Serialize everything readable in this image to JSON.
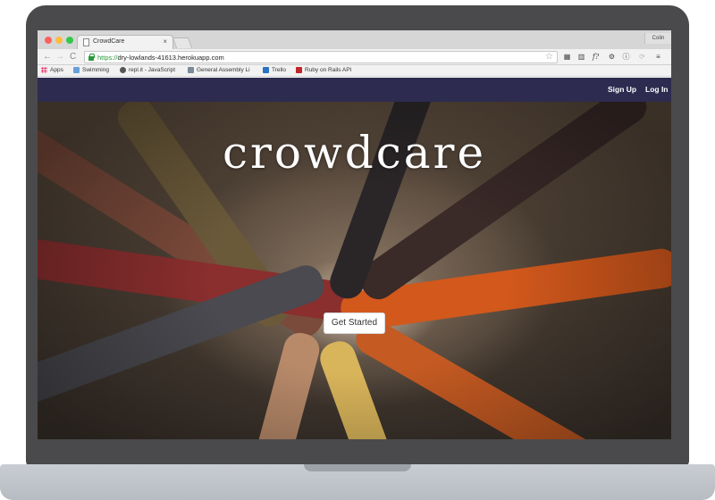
{
  "browser": {
    "tab_title": "CrowdCare",
    "tab_close": "×",
    "profile_name": "Colin",
    "url_protocol": "https://",
    "url_host": "dry-lowlands-41613.herokuapp.com",
    "star_icon": "☆",
    "extensions": [
      "▦",
      "▥",
      "f?",
      "⚙",
      "ⓘ",
      "⟳",
      "≡"
    ],
    "nav": {
      "back": "←",
      "forward": "→",
      "reload": "C"
    }
  },
  "bookmarks": [
    {
      "label": "Apps",
      "icon": "apps-icon"
    },
    {
      "label": "Swimming",
      "icon": "swim-icon"
    },
    {
      "label": "repl.it - JavaScript",
      "icon": "repl-icon"
    },
    {
      "label": "General Assembly Li",
      "icon": "folder-icon"
    },
    {
      "label": "Trello",
      "icon": "trello-icon"
    },
    {
      "label": "Ruby on Rails API",
      "icon": "rails-icon"
    }
  ],
  "site": {
    "nav": {
      "signup": "Sign Up",
      "login": "Log In"
    },
    "hero_title": "crowdcare",
    "cta_label": "Get Started"
  },
  "colors": {
    "navbar": "#2d2b4f",
    "frame": "#4a4a4c",
    "secure_green": "#2a9a3a"
  }
}
